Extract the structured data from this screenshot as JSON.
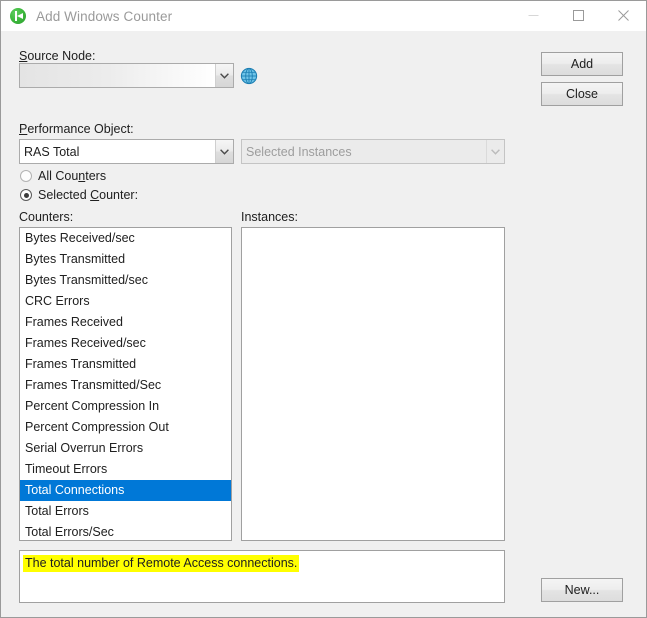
{
  "window": {
    "title": "Add Windows Counter",
    "app_icon": "kaseya-green-circle-icon",
    "controls": {
      "minimize": "minimize-icon",
      "maximize": "maximize-icon",
      "close": "close-icon"
    }
  },
  "form": {
    "source_node": {
      "label": "Source Node:",
      "label_accesskey": "S",
      "value": "",
      "placeholder": "",
      "browse_icon": "globe-icon"
    },
    "performance_object": {
      "label": "Performance Object:",
      "label_accesskey": "P",
      "value": "RAS Total"
    },
    "instances_select": {
      "value": "Selected Instances",
      "disabled": true
    },
    "counter_mode": {
      "all_counters": {
        "label": "All Counters",
        "accesskey": "n",
        "selected": false
      },
      "selected_counter": {
        "label": "Selected Counter:",
        "accesskey": "C",
        "selected": true
      }
    }
  },
  "counters": {
    "label": "Counters:",
    "items": [
      "Bytes Received/sec",
      "Bytes Transmitted",
      "Bytes Transmitted/sec",
      "CRC Errors",
      "Frames Received",
      "Frames Received/sec",
      "Frames Transmitted",
      "Frames Transmitted/Sec",
      "Percent Compression In",
      "Percent Compression Out",
      "Serial Overrun Errors",
      "Timeout Errors",
      "Total Connections",
      "Total Errors",
      "Total Errors/Sec"
    ],
    "selected_index": 12
  },
  "instances": {
    "label": "Instances:",
    "items": []
  },
  "description": {
    "text": "The total number of Remote Access connections.",
    "highlight_color": "#ffff00"
  },
  "buttons": {
    "add": "Add",
    "close": "Close",
    "new": "New..."
  },
  "colors": {
    "selection_blue": "#0078d7",
    "window_background": "#f0f0f0",
    "titlebar_background": "#ffffff",
    "highlight_yellow": "#ffff00"
  }
}
